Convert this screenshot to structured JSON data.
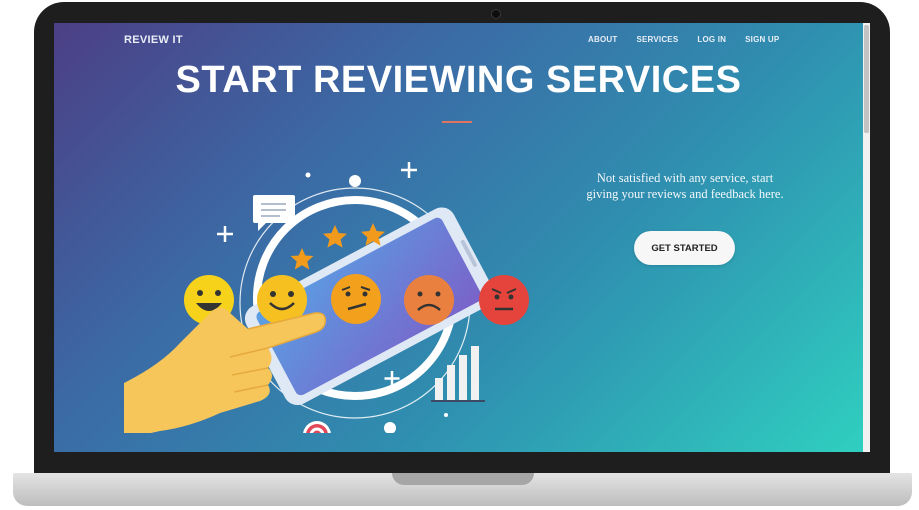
{
  "brand": {
    "name": "REVIEW IT"
  },
  "nav": {
    "items": [
      "ABOUT",
      "SERVICES",
      "LOG IN",
      "SIGN UP"
    ]
  },
  "hero": {
    "title": "START REVIEWING SERVICES",
    "tagline_line1": "Not satisfied with any service, start",
    "tagline_line2": "giving your reviews and feedback here.",
    "cta_label": "GET STARTED"
  },
  "illustration": {
    "rating_icons": [
      "laughing-face-icon",
      "smiling-face-icon",
      "skeptical-face-icon",
      "sad-face-icon",
      "angry-face-icon"
    ],
    "rating_colors": [
      "#f7d21a",
      "#f6c120",
      "#f3a11d",
      "#e9803f",
      "#e4443b"
    ],
    "stars": 3,
    "star_color": "#f29a1c"
  },
  "colors": {
    "gradient_start": "#4c3f86",
    "gradient_end": "#2fd0c0",
    "divider": "#e0735d",
    "cta_background": "#f7f7f7"
  }
}
